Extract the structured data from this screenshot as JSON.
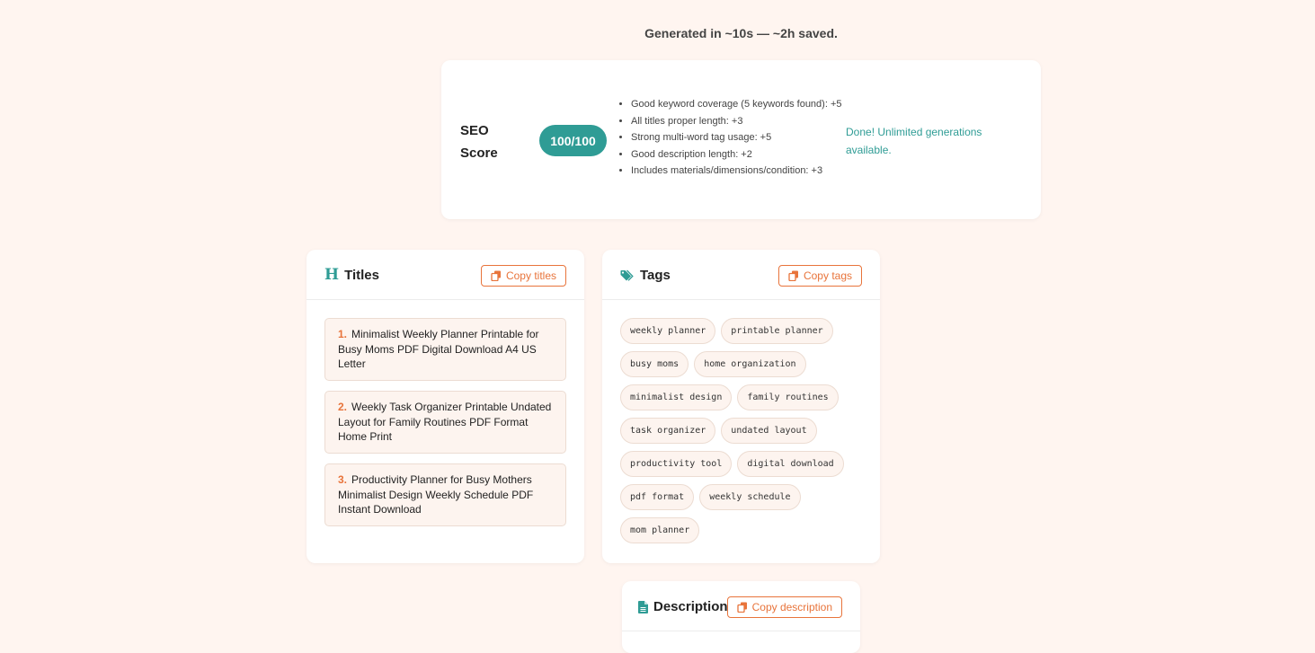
{
  "banner": "Generated in ~10s — ~2h saved.",
  "seo": {
    "label_line1": "SEO",
    "label_line2": "Score",
    "score": "100/100",
    "checks": [
      "Good keyword coverage (5 keywords found): +5",
      "All titles proper length: +3",
      "Strong multi-word tag usage: +5",
      "Good description length: +2",
      "Includes materials/dimensions/condition: +3"
    ],
    "status": "Done! Unlimited generations available."
  },
  "titles": {
    "heading": "Titles",
    "icon": "heading-icon",
    "copy_label": "Copy titles",
    "items": [
      {
        "num": "1.",
        "text": "Minimalist Weekly Planner Printable for Busy Moms PDF Digital Download A4 US Letter"
      },
      {
        "num": "2.",
        "text": "Weekly Task Organizer Printable Undated Layout for Family Routines PDF Format Home Print"
      },
      {
        "num": "3.",
        "text": "Productivity Planner for Busy Mothers Minimalist Design Weekly Schedule PDF Instant Download"
      }
    ]
  },
  "tags": {
    "heading": "Tags",
    "icon": "tag-icon",
    "copy_label": "Copy tags",
    "items": [
      "weekly planner",
      "printable planner",
      "busy moms",
      "home organization",
      "minimalist design",
      "family routines",
      "task organizer",
      "undated layout",
      "productivity tool",
      "digital download",
      "pdf format",
      "weekly schedule",
      "mom planner"
    ]
  },
  "description": {
    "heading": "Description",
    "icon": "document-icon",
    "copy_label": "Copy description"
  },
  "colors": {
    "accent": "#2f9c95",
    "copy_orange": "#e8743b",
    "background": "#fff5f0"
  }
}
